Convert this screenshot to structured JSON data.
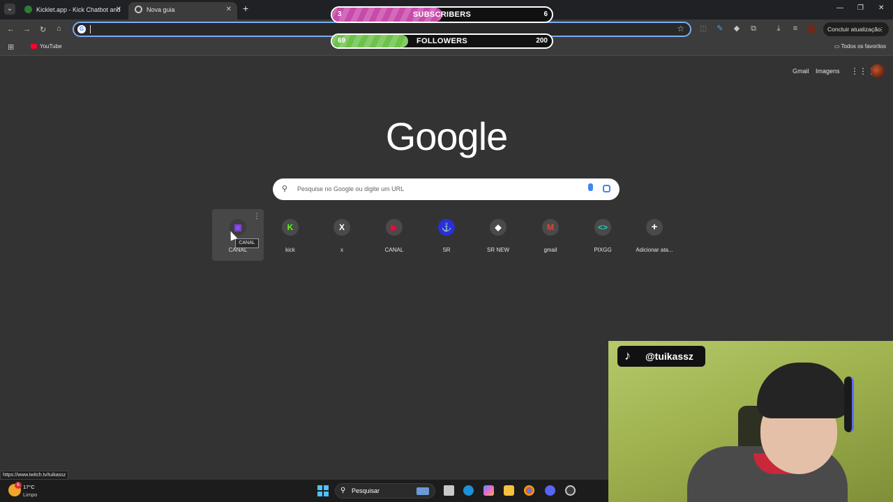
{
  "browser": {
    "tabs": [
      {
        "title": "Kicklet.app - Kick Chatbot and",
        "active": false
      },
      {
        "title": "Nova guia",
        "active": true
      }
    ],
    "omnibox_value": "",
    "update_button": "Concluir atualização",
    "bookmarks": [
      {
        "label": "YouTube"
      }
    ],
    "all_bookmarks_label": "Todos os favoritos"
  },
  "overlay": {
    "subscribers": {
      "current": "3",
      "label": "SUBSCRIBERS",
      "goal": "6",
      "progress_fraction": 0.5,
      "color": "#c84aaa"
    },
    "followers": {
      "current": "69",
      "label": "FOLLOWERS",
      "goal": "200",
      "progress_fraction": 0.345,
      "color": "#6cc24a"
    }
  },
  "ntp": {
    "top_links": [
      "Gmail",
      "Imagens"
    ],
    "logo_text": "Google",
    "search_placeholder": "Pesquise no Google ou digite um URL",
    "shortcuts": [
      {
        "name": "CANAL",
        "icon": "twitch-icon",
        "color": "#9146ff",
        "hovered": true
      },
      {
        "name": "kick",
        "icon": "kick-icon",
        "color": "#53fc18"
      },
      {
        "name": "x",
        "icon": "x-icon",
        "color": "#ffffff"
      },
      {
        "name": "CANAL",
        "icon": "youtube-icon",
        "color": "#ff0033"
      },
      {
        "name": "SR",
        "icon": "sr-icon",
        "color": "#3b4cff"
      },
      {
        "name": "SR NEW",
        "icon": "sr-new-icon",
        "color": "#ffffff"
      },
      {
        "name": "gmail",
        "icon": "gmail-icon",
        "color": "#ea4335"
      },
      {
        "name": "PIXGG",
        "icon": "pixgg-icon",
        "color": "#1fd1b0"
      },
      {
        "name": "Adicionar ata...",
        "icon": "plus-icon",
        "color": "#ffffff"
      }
    ],
    "tooltip": "CANAL"
  },
  "status_url": "https://www.twitch.tv/tuikassz",
  "taskbar": {
    "weather_badge": "6",
    "temperature": "17°C",
    "condition": "Limpo",
    "search_label": "Pesquisar"
  },
  "webcam": {
    "tiktok_handle": "@tuikassz"
  }
}
